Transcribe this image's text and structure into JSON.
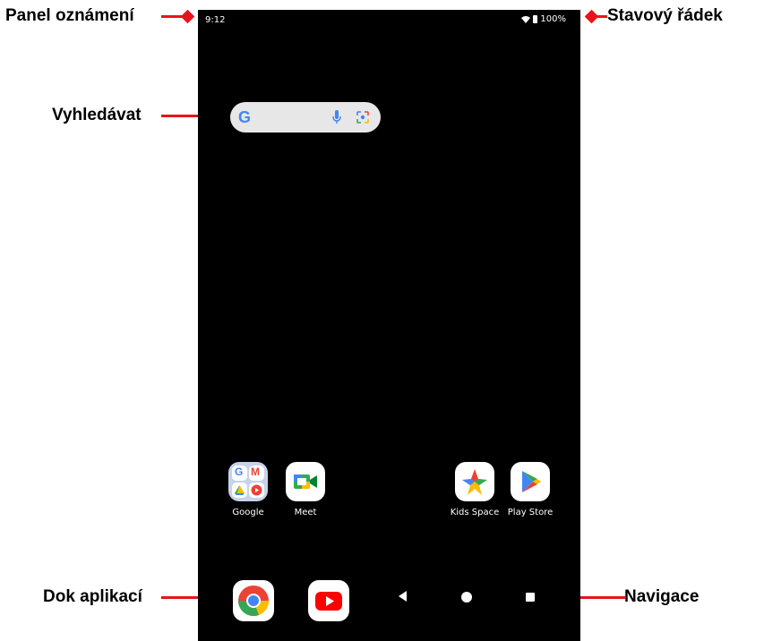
{
  "callouts": {
    "notification_panel": "Panel oznámení",
    "status_bar": "Stavový řádek",
    "search": "Vyhledávat",
    "app_dock": "Dok aplikací",
    "navigation": "Navigace"
  },
  "status": {
    "time": "9:12",
    "battery": "100%"
  },
  "apps": [
    {
      "label": "Google",
      "icon": "google-folder-icon"
    },
    {
      "label": "Meet",
      "icon": "meet-icon"
    },
    {
      "label": "Kids Space",
      "icon": "kids-space-icon"
    },
    {
      "label": "Play Store",
      "icon": "play-store-icon"
    }
  ],
  "dock": [
    {
      "icon": "chrome-icon"
    },
    {
      "icon": "youtube-icon"
    }
  ],
  "colors": {
    "callout": "#e8141c",
    "screen": "#000000"
  }
}
